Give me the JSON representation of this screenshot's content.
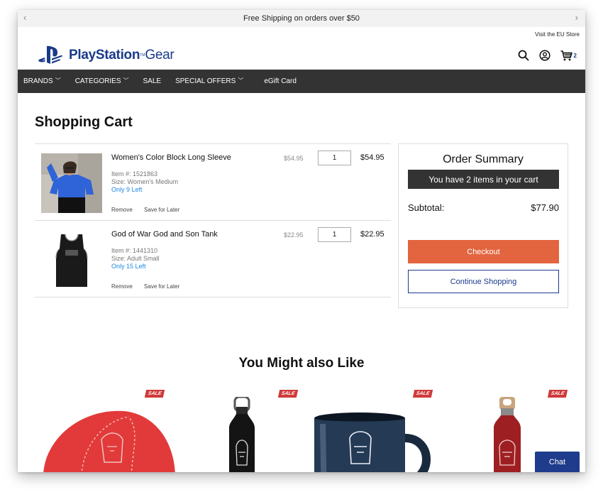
{
  "promo": {
    "text": "Free Shipping on orders over $50"
  },
  "topbar": {
    "eu_store": "Visit the EU Store"
  },
  "header": {
    "brand": "PlayStation",
    "tm": "TM",
    "gear": "Gear",
    "cart_count": "2"
  },
  "nav": {
    "items": [
      {
        "label": "BRANDS",
        "dropdown": true
      },
      {
        "label": "CATEGORIES",
        "dropdown": true
      },
      {
        "label": "SALE",
        "dropdown": false
      },
      {
        "label": "SPECIAL OFFERS",
        "dropdown": true
      },
      {
        "label": "eGift Card",
        "dropdown": false
      }
    ]
  },
  "page": {
    "title": "Shopping Cart"
  },
  "cart": {
    "items": [
      {
        "name": "Women's Color Block Long Sleeve",
        "item_no": "Item #: 1521863",
        "size": "Size: Women's Medium",
        "stock": "Only 9 Left",
        "unit_price": "$54.95",
        "qty": "1",
        "total": "$54.95",
        "remove": "Remove",
        "save": "Save for Later"
      },
      {
        "name": "God of War God and Son Tank",
        "item_no": "Item #: 1441310",
        "size": "Size: Adult Small",
        "stock": "Only 15 Left",
        "unit_price": "$22.95",
        "qty": "1",
        "total": "$22.95",
        "remove": "Remove",
        "save": "Save for Later"
      }
    ]
  },
  "summary": {
    "title": "Order Summary",
    "items_note": "You have 2 items in your cart",
    "subtotal_label": "Subtotal:",
    "subtotal_value": "$77.90",
    "checkout": "Checkout",
    "continue": "Continue Shopping"
  },
  "recommendations": {
    "title": "You Might also Like",
    "sale_badge": "SALE"
  },
  "chat": {
    "label": "Chat"
  },
  "colors": {
    "accent": "#1a3a8a",
    "checkout": "#e2653f",
    "sale": "#d03a3a",
    "nav": "#333333",
    "stock": "#1e88e5"
  }
}
